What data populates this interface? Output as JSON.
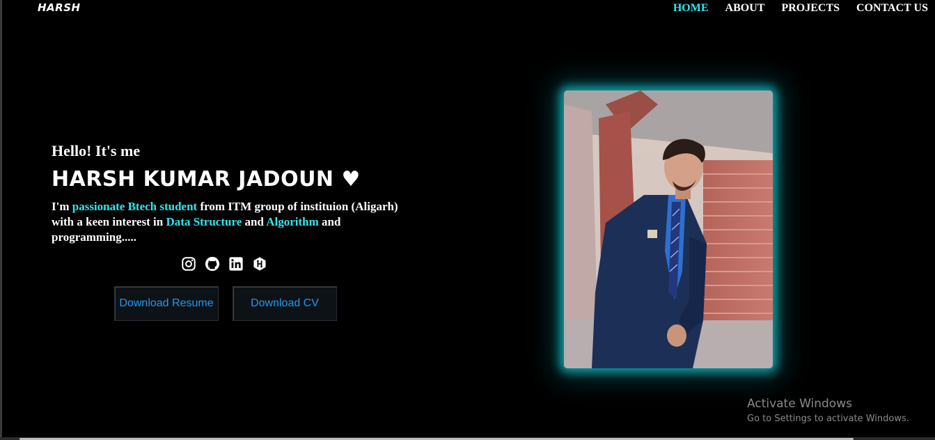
{
  "header": {
    "logo": "HARSH",
    "nav": [
      {
        "label": "HOME",
        "active": true
      },
      {
        "label": "ABOUT",
        "active": false
      },
      {
        "label": "PROJECTS",
        "active": false
      },
      {
        "label": "CONTACT US",
        "active": false
      }
    ]
  },
  "hero": {
    "greeting": "Hello! It's me",
    "name": "HARSH KUMAR JADOUN ♥",
    "intro": {
      "p1": "I'm ",
      "h1": "passionate Btech student",
      "p2": " from ITM group of instituion (Aligarh) with a keen interest in ",
      "h2": "Data Structure",
      "p3": " and ",
      "h3": "Algorithm",
      "p4": " and programming....."
    },
    "socials": [
      "instagram-icon",
      "github-icon",
      "linkedin-icon",
      "hackerrank-icon"
    ],
    "buttons": {
      "resume": "Download Resume",
      "cv": "Download CV"
    }
  },
  "windows_watermark": {
    "title": "Activate Windows",
    "subtitle": "Go to Settings to activate Windows."
  },
  "colors": {
    "accent": "#2ee6ee",
    "button_text": "#1f9bf0",
    "background": "#000000"
  }
}
